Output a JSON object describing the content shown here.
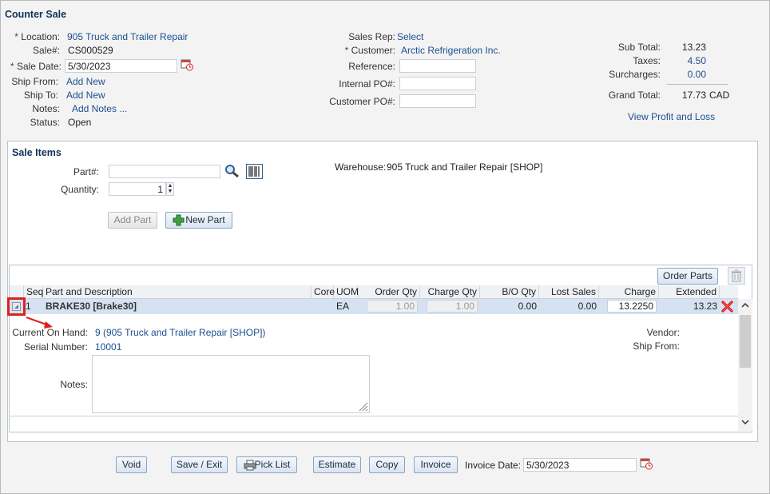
{
  "window": {
    "title": "Counter Sale"
  },
  "header": {
    "location_label": "Location:",
    "location_value": "905 Truck and Trailer Repair",
    "sale_no_label": "Sale#:",
    "sale_no_value": "CS000529",
    "sale_date_label": "Sale Date:",
    "sale_date_value": "5/30/2023",
    "ship_from_label": "Ship From:",
    "ship_from_value": "Add New",
    "ship_to_label": "Ship To:",
    "ship_to_value": "Add New",
    "notes_label": "Notes:",
    "notes_value": "Add Notes ...",
    "status_label": "Status:",
    "status_value": "Open",
    "sales_rep_label": "Sales Rep:",
    "sales_rep_value": "Select",
    "customer_label": "Customer:",
    "customer_value": "Arctic Refrigeration Inc.",
    "reference_label": "Reference:",
    "reference_value": "",
    "internal_po_label": "Internal PO#:",
    "internal_po_value": "",
    "customer_po_label": "Customer PO#:",
    "customer_po_value": "",
    "required_mark": "*"
  },
  "totals": {
    "sub_total_label": "Sub Total:",
    "sub_total_value": "13.23",
    "taxes_label": "Taxes:",
    "taxes_value": "4.50",
    "surcharges_label": "Surcharges:",
    "surcharges_value": "0.00",
    "grand_total_label": "Grand Total:",
    "grand_total_value": "17.73",
    "currency": "CAD",
    "view_pl_link": "View Profit and Loss"
  },
  "sale_items": {
    "title": "Sale Items",
    "part_label": "Part#:",
    "part_value": "",
    "quantity_label": "Quantity:",
    "quantity_value": "1",
    "warehouse_label": "Warehouse:",
    "warehouse_value": "905 Truck and Trailer Repair [SHOP]",
    "add_part_button": "Add Part",
    "new_part_button": "New Part",
    "order_parts_button": "Order Parts"
  },
  "grid": {
    "columns": [
      "Seq",
      "Part and Description",
      "Core",
      "UOM",
      "Order Qty",
      "Charge Qty",
      "B/O Qty",
      "Lost Sales",
      "Charge",
      "Extended"
    ],
    "rows": [
      {
        "seq": "1",
        "part": "BRAKE30 [Brake30]",
        "core": "",
        "uom": "EA",
        "order_qty": "1.00",
        "charge_qty": "1.00",
        "bo_qty": "0.00",
        "lost_sales": "0.00",
        "charge": "13.2250",
        "extended": "13.23"
      }
    ]
  },
  "detail": {
    "on_hand_label": "Current On Hand:",
    "on_hand_value": "9 (905 Truck and Trailer Repair [SHOP])",
    "serial_label": "Serial Number:",
    "serial_value": "10001",
    "notes_label": "Notes:",
    "notes_value": "",
    "vendor_label": "Vendor:",
    "vendor_value": "",
    "ship_from_label": "Ship From:",
    "ship_from_value": ""
  },
  "footer": {
    "void_button": "Void",
    "save_exit_button": "Save / Exit",
    "pick_list_button": "Pick List",
    "estimate_button": "Estimate",
    "copy_button": "Copy",
    "invoice_button": "Invoice",
    "invoice_date_label": "Invoice Date:",
    "invoice_date_value": "5/30/2023"
  },
  "colors": {
    "link": "#1c4f8f",
    "highlight": "#e02020",
    "row_selected": "#d5e2f1"
  },
  "icons": [
    "calendar-clock-icon",
    "search-icon",
    "barcode-icon",
    "plus-icon",
    "trash-icon",
    "delete-x-icon",
    "printer-icon",
    "expand-toggle-icon",
    "arrow-annotation-icon",
    "scroll-up-icon",
    "scroll-down-icon"
  ]
}
